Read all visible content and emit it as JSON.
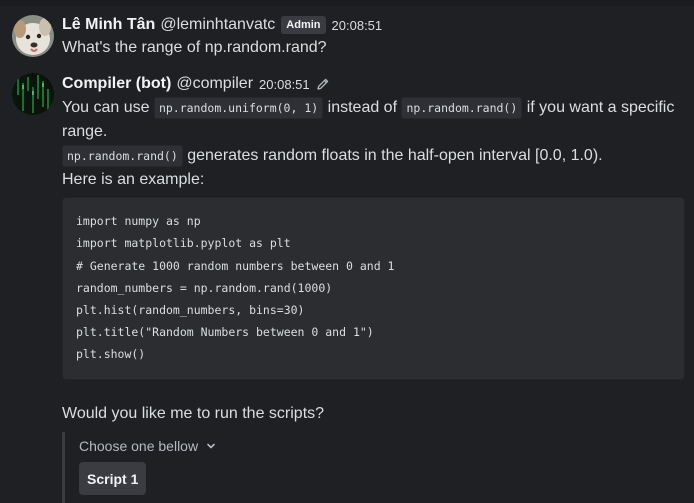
{
  "messages": [
    {
      "author": "Lê Minh Tân",
      "handle": "@leminhtanvatc",
      "badge": "Admin",
      "time": "20:08:51",
      "text": "What's the range of np.random.rand?",
      "avatar_icon": "dog-avatar-icon"
    },
    {
      "author": "Compiler (bot)",
      "handle": "@compiler",
      "time": "20:08:51",
      "edit_icon": "pencil-icon",
      "avatar_icon": "matrix-avatar-icon",
      "line1": {
        "a": "You can use",
        "code1": "np.random.uniform(0, 1)",
        "b": "instead of",
        "code2": "np.random.rand()",
        "c": "if you want a specific"
      },
      "line2": "range.",
      "line3": {
        "code": "np.random.rand()",
        "text": "generates random floats in the half-open interval [0.0, 1.0)."
      },
      "line4": "Here is an example:",
      "code_lines": [
        "import numpy as np",
        "import matplotlib.pyplot as plt",
        "# Generate 1000 random numbers between 0 and 1",
        "random_numbers = np.random.rand(1000)",
        "plt.hist(random_numbers, bins=30)",
        "plt.title(\"Random Numbers between 0 and 1\")",
        "plt.show()"
      ],
      "question": "Would you like me to run the scripts?",
      "select": {
        "placeholder": "Choose one bellow",
        "chevron_icon": "chevron-down-icon",
        "options": [
          "Script 1"
        ]
      }
    }
  ],
  "colors": {
    "background": "#1f2023",
    "code_bg": "#2b2d31",
    "text": "#dbdee1",
    "muted": "#b5bac1",
    "badge_bg": "#3a3c41"
  }
}
